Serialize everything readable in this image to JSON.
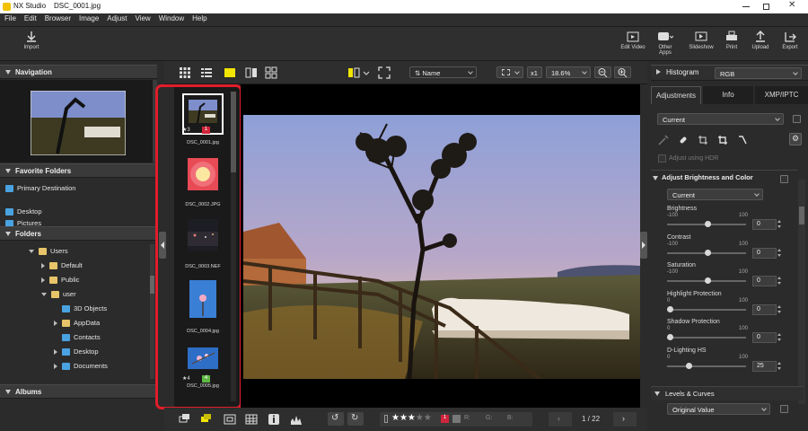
{
  "window": {
    "app_title": "NX Studio",
    "file_title": "DSC_0001.jpg"
  },
  "menu": [
    "File",
    "Edit",
    "Browser",
    "Image",
    "Adjust",
    "View",
    "Window",
    "Help"
  ],
  "toolbar": {
    "import": "Import",
    "edit_video": "Edit Video",
    "other_apps": "Other Apps",
    "slideshow": "Slideshow",
    "print": "Print",
    "upload": "Upload",
    "export": "Export"
  },
  "left": {
    "navigation": "Navigation",
    "favorite_folders": "Favorite Folders",
    "favorites": [
      "Primary Destination",
      "Desktop",
      "Pictures"
    ],
    "folders": "Folders",
    "tree": [
      "Users",
      "Default",
      "Public",
      "user",
      "3D Objects",
      "AppData",
      "Contacts",
      "Desktop",
      "Documents"
    ],
    "albums": "Albums"
  },
  "viewbar": {
    "sort_label": "Name",
    "zoom_factor": "x1",
    "zoom_percent": "18.6%"
  },
  "filmstrip": [
    {
      "name": "DSC_0001.jpg",
      "rating": "3",
      "label": "1",
      "label_color": "#d0243a"
    },
    {
      "name": "DSC_0002.JPG"
    },
    {
      "name": "DSC_0003.NEF"
    },
    {
      "name": "DSC_0004.jpg"
    },
    {
      "name": "DSC_0005.jpg",
      "rating": "4",
      "label": "4",
      "label_color": "#5fb843"
    }
  ],
  "bottombar": {
    "label_value": "1",
    "rgb_r": "R:",
    "rgb_g": "G:",
    "rgb_b": "B:",
    "page": "1 / 22"
  },
  "right": {
    "histogram": "Histogram",
    "histogram_mode": "RGB",
    "tabs": [
      "Adjustments",
      "Info",
      "XMP/IPTC"
    ],
    "preset": "Current",
    "hdr_label": "Adjust using HDR",
    "section1": "Adjust Brightness and Color",
    "section1_preset": "Current",
    "adjustments": [
      {
        "label": "Brightness",
        "min": "-100",
        "max": "100",
        "value": "0",
        "knob": 0.5
      },
      {
        "label": "Contrast",
        "min": "-100",
        "max": "100",
        "value": "0",
        "knob": 0.5
      },
      {
        "label": "Saturation",
        "min": "-100",
        "max": "100",
        "value": "0",
        "knob": 0.5
      },
      {
        "label": "Highlight Protection",
        "min": "0",
        "max": "100",
        "value": "0",
        "knob": 0.0
      },
      {
        "label": "Shadow Protection",
        "min": "0",
        "max": "100",
        "value": "0",
        "knob": 0.0
      },
      {
        "label": "D-Lighting HS",
        "min": "0",
        "max": "100",
        "value": "25",
        "knob": 0.25
      }
    ],
    "section2": "Levels & Curves",
    "section2_preset": "Original Value"
  },
  "colors": {
    "accent": "#e11d2a",
    "label_yellow": "#f2e500",
    "folder": "#e7c46a"
  }
}
